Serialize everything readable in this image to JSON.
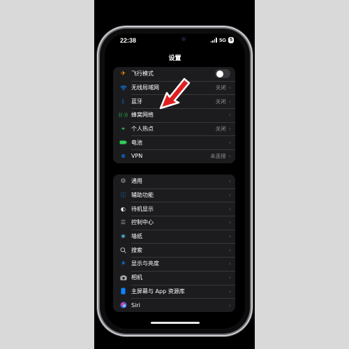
{
  "status": {
    "time": "22:38",
    "network": "5G",
    "battery": "5"
  },
  "page": {
    "title": "设置"
  },
  "group1": [
    {
      "label": "飞行模式",
      "icon": "airplane-icon",
      "color": "#ff9500",
      "control": "toggle"
    },
    {
      "label": "无线局域网",
      "icon": "wifi-icon",
      "color": "#0a84ff",
      "value": "关闭"
    },
    {
      "label": "蓝牙",
      "icon": "bluetooth-icon",
      "color": "#0a84ff",
      "value": "关闭"
    },
    {
      "label": "蜂窝网络",
      "icon": "cellular-icon",
      "color": "#30d158",
      "value": ""
    },
    {
      "label": "个人热点",
      "icon": "hotspot-icon",
      "color": "#30d158",
      "value": "关闭"
    },
    {
      "label": "电池",
      "icon": "battery-icon",
      "color": "#30d158",
      "value": ""
    },
    {
      "label": "VPN",
      "icon": "vpn-icon",
      "color": "#0a84ff",
      "value": "未连接"
    }
  ],
  "group2": [
    {
      "label": "通用",
      "icon": "gear-icon",
      "color": "#8e8e93"
    },
    {
      "label": "辅助功能",
      "icon": "accessibility-icon",
      "color": "#0a84ff"
    },
    {
      "label": "待机显示",
      "icon": "standby-icon",
      "color": "#1c1c1e"
    },
    {
      "label": "控制中心",
      "icon": "control-center-icon",
      "color": "#8e8e93"
    },
    {
      "label": "墙纸",
      "icon": "wallpaper-icon",
      "color": "#5ac8fa"
    },
    {
      "label": "搜索",
      "icon": "search-icon",
      "color": "#8e8e93"
    },
    {
      "label": "显示与亮度",
      "icon": "brightness-icon",
      "color": "#0a84ff"
    },
    {
      "label": "相机",
      "icon": "camera-icon",
      "color": "#8e8e93"
    },
    {
      "label": "主屏幕与 App 资源库",
      "icon": "home-screen-icon",
      "color": "#0a84ff"
    },
    {
      "label": "Siri",
      "icon": "siri-icon",
      "color": "#1c1c1e"
    }
  ],
  "annotation": {
    "arrow_color": "#e02020"
  }
}
